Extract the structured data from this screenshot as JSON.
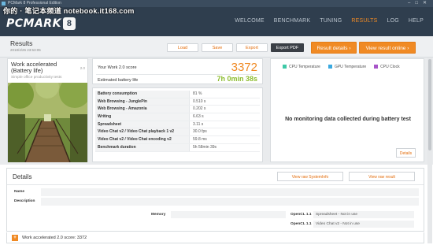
{
  "titlebar": {
    "text": "PCMark 8 Professional Edition",
    "watermark": "你的 · 笔记本频道 notebook.it168.com"
  },
  "logo": {
    "text": "PCMARK",
    "badge": "8"
  },
  "nav": [
    "WELCOME",
    "BENCHMARK",
    "TUNING",
    "RESULTS",
    "LOG",
    "HELP"
  ],
  "nav_active": "RESULTS",
  "results_bar": {
    "title": "Results",
    "date": "2018/4/26 23:53:05",
    "load": "Load",
    "save": "Save",
    "export": "Export",
    "export_pdf": "Export PDF",
    "result_details": "Result details",
    "view_online": "View result online"
  },
  "test_card": {
    "title_line1": "Work accelerated",
    "title_line2": "(Battery life)",
    "subtitle": "Simple office productivity tests",
    "version": "2.0"
  },
  "score": {
    "label": "Your Work 2.0 score",
    "value": "3372",
    "battery_label": "Estimated battery life",
    "battery_value": "7h 0min 38s"
  },
  "metrics": [
    {
      "key": "Battery consumption",
      "value": "81 %"
    },
    {
      "key": "Web Browsing - JunglePin",
      "value": "0.510 s"
    },
    {
      "key": "Web Browsing - Amazonia",
      "value": "0.202 s"
    },
    {
      "key": "Writing",
      "value": "6.63 s"
    },
    {
      "key": "Spreadsheet",
      "value": "3.11 s"
    },
    {
      "key": "Video Chat v2 / Video Chat playback 1 v2",
      "value": "30.0 fps"
    },
    {
      "key": "Video Chat v2 / Video Chat encoding v2",
      "value": "59.8 ms"
    },
    {
      "key": "Benchmark duration",
      "value": "5h 58min 39s"
    }
  ],
  "monitor": {
    "legend": [
      {
        "label": "CPU Temperature",
        "color": "#3ec9a7"
      },
      {
        "label": "GPU Temperature",
        "color": "#3aa9e0"
      },
      {
        "label": "CPU Clock",
        "color": "#a855c9"
      }
    ],
    "nodata": "No monitoring data collected during battery test",
    "details": "Details"
  },
  "details": {
    "title": "Details",
    "view_sysinfo": "View raw SystemInfo",
    "view_result": "View raw result",
    "name_label": "Name",
    "description_label": "Description",
    "memory_label": "Memory",
    "opencl1_label": "OpenCL 1.1",
    "opencl1_value": "Spreadsheet - Not in use",
    "opencl2_label": "OpenCL 1.1",
    "opencl2_value": "Video Chat v2 - Not in use"
  },
  "footer": {
    "expander": "+",
    "text": "Work accelerated 2.0 score: 3372"
  }
}
